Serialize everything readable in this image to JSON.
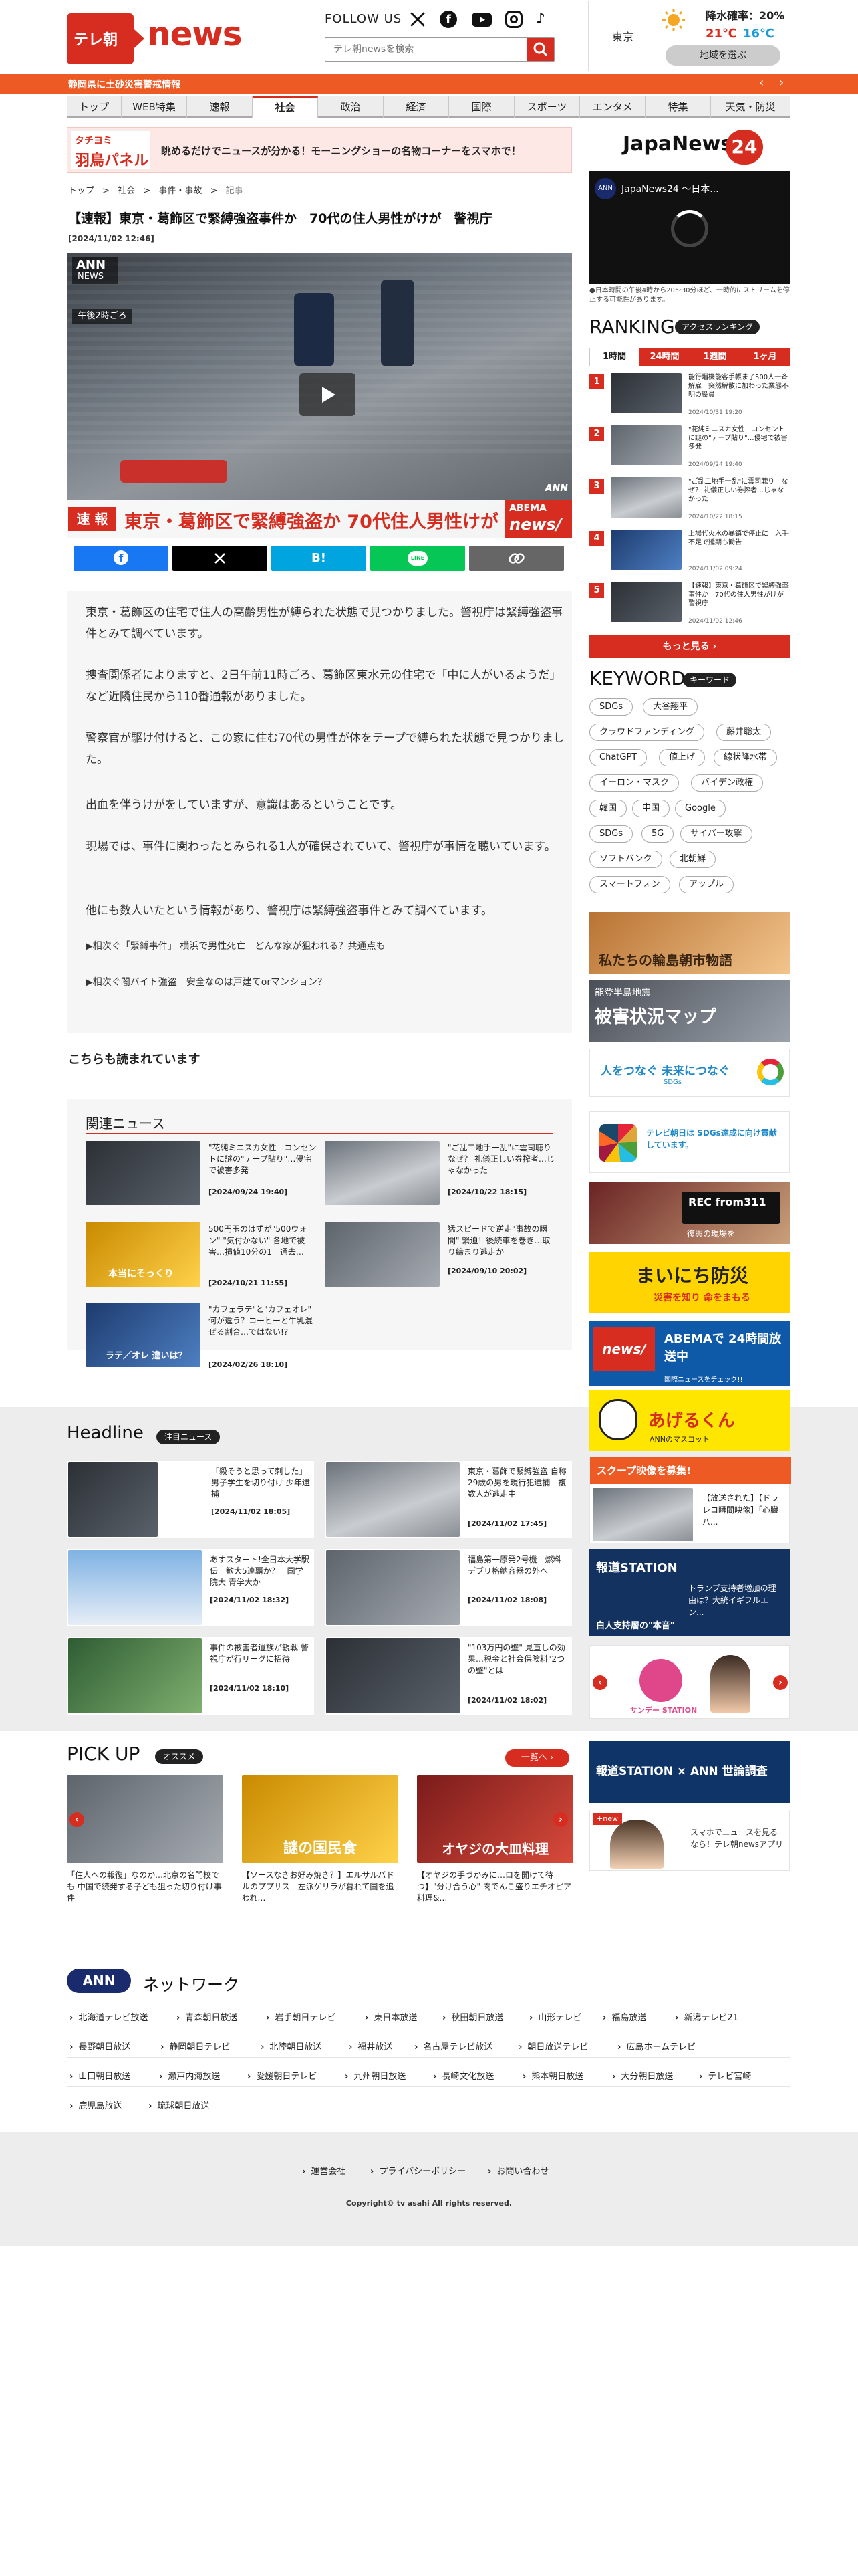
{
  "header": {
    "logo_mark": "テレ朝",
    "logo_word": "news",
    "follow_label": "FOLLOW US",
    "search_placeholder": "テレ朝newsを検索",
    "weather": {
      "city": "東京",
      "precip_label": "降水確率：20%",
      "temp_high": "21℃",
      "temp_low": "16℃",
      "region_button": "地域を選ぶ"
    }
  },
  "alert_bar": {
    "text": "静岡県に土砂災害警戒情報"
  },
  "nav": {
    "items": [
      "トップ",
      "WEB特集",
      "速報",
      "社会",
      "政治",
      "経済",
      "国際",
      "スポーツ",
      "エンタメ",
      "特集",
      "天気・防災"
    ],
    "active": "社会"
  },
  "promo_banner": {
    "badge_top": "タチヨミ",
    "badge_bottom": "羽鳥パネル",
    "text": "眺めるだけでニュースが分かる！モーニングショーの名物コーナーをスマホで！"
  },
  "breadcrumb": [
    "トップ",
    "社会",
    "事件・事故",
    "記事"
  ],
  "article": {
    "title": "【速報】東京・葛飾区で緊縛強盗事件か　70代の住人男性がけが　警視庁",
    "date": "[2024/11/02 12:46]",
    "video": {
      "ann_logo": "ANN",
      "news_logo": "NEWS",
      "time_label": "午後2時ごろ",
      "breaking_badge": "速 報",
      "caption": "東京・葛飾区で緊縛強盗か 70代住人男性けが",
      "abema_top": "ABEMA",
      "abema_bottom": "news/",
      "ann_corner": "ANN"
    },
    "share": [
      "Facebook",
      "X",
      "B!",
      "LINE",
      "リンク"
    ],
    "paragraphs": [
      "東京・葛飾区の住宅で住人の高齢男性が縛られた状態で見つかりました。警視庁は緊縛強盗事件とみて調べています。",
      "捜査関係者によりますと、2日午前11時ごろ、葛飾区東水元の住宅で「中に人がいるようだ」など近隣住民から110番通報がありました。",
      "警察官が駆け付けると、この家に住む70代の男性が体をテープで縛られた状態で見つかりました。",
      "出血を伴うけがをしていますが、意識はあるということです。",
      "現場では、事件に関わったとみられる1人が確保されていて、警視庁が事情を聴いています。",
      "他にも数人いたという情報があり、警視庁は緊縛強盗事件とみて調べています。"
    ],
    "related_links": [
      "▶相次ぐ「緊縛事件」 横浜で男性死亡　どんな家が狙われる？共通点も",
      "▶相次ぐ闇バイト強盗　安全なのは戸建てorマンション？"
    ]
  },
  "also_read": {
    "title": "こちらも読まれています"
  },
  "related_news": {
    "title": "関連ニュース",
    "items": [
      {
        "title": "\"花純ミニスカ女性　コンセントに謎の\"テープ貼り\"…侵宅で被害多発",
        "date": "[2024/09/24 19:40]"
      },
      {
        "title": "\"ご乱二地手一乱\"に雲司聴り　なぜ？ 礼儀正しい券搾者…じゃなかった",
        "date": "[2024/10/22 18:15]"
      },
      {
        "title": "500円玉のはずが\"500ウォン\" \"気付かない\" 各地で被害…損値10分の1　通去…",
        "date": "[2024/10/21 11:55]",
        "thumb_text": "本当にそっくり"
      },
      {
        "title": "猛スピードで逆走\"事故の瞬間\" 緊迫！後続車を巻き…取り締まり逃走か",
        "date": "[2024/09/10 20:02]"
      },
      {
        "title": "\"カフェラテ\"と\"カフェオレ\" 何が違う？コーヒーと牛乳混ぜる割合…ではない!?",
        "date": "[2024/02/26 18:10]",
        "thumb_text": "ラテ／オレ 違いは？"
      }
    ]
  },
  "headline": {
    "title": "Headline",
    "badge": "注目ニュース",
    "items": [
      {
        "title": "「殺そうと思って刺した」男子学生を切り付け 少年逮捕",
        "date": "[2024/11/02 18:05]"
      },
      {
        "title": "東京・葛飾で緊縛強盗 自称29歳の男を現行犯逮捕　複数人が逃走中",
        "date": "[2024/11/02 17:45]"
      },
      {
        "title": "あすスタート!全日本大学駅伝　歓大5連覇か？　国学院大 青学大か",
        "date": "[2024/11/02 18:32]"
      },
      {
        "title": "福島第一原発2号機　燃料デブリ格納容器の外へ",
        "date": "[2024/11/02 18:08]"
      },
      {
        "title": "事件の被害者遺族が観戦 警視庁が行リーグに招待",
        "date": "[2024/11/02 18:10]"
      },
      {
        "title": "\"103万円の壁\" 見直しの効果…税金と社会保険料\"2つの壁\"とは",
        "date": "[2024/11/02 18:02]"
      }
    ]
  },
  "pickup": {
    "title": "PICK UP",
    "badge": "オススメ",
    "more_label": "一覧へ",
    "items": [
      {
        "title": "「住人への報復」なのか…北京の名門校でも 中国で続発する子ども狙った切り付け事件"
      },
      {
        "title": "【ソースなきお好み焼き？】エルサルバドルのププサス　左派ゲリラが暮れて国を追われ…",
        "thumb_text": "謎の国民食"
      },
      {
        "title": "【オヤジの手づかみに…ロを開けて待つ】\"分け合う心\" 肉でんこ盛りエチオピア料理&…",
        "thumb_text": "オヤジの大皿料理"
      }
    ]
  },
  "sidebar": {
    "japannews": {
      "logo": "JapaNews",
      "logo_num": "24",
      "video_title": "JapaNews24 ～日本...",
      "note": "●日本時間の午後4時から20～30分ほど、一時的にストリームを停止する可能性があります。"
    },
    "ranking": {
      "title": "RANKING",
      "badge": "アクセスランキング",
      "tabs": [
        "1時間",
        "24時間",
        "1週間",
        "1ヶ月"
      ],
      "active_tab": "1時間",
      "items": [
        {
          "rank": "1",
          "title": "能行増機能客手帳ま了500人一斉解雇　突然解散に加わった業態不明の役員",
          "date": "2024/10/31 19:20"
        },
        {
          "rank": "2",
          "title": "\"花純ミニスカ女性　コンセントに謎の\"テープ貼り\"…侵宅で被害多発",
          "date": "2024/09/24 19:40"
        },
        {
          "rank": "3",
          "title": "\"ご乱二地手一乱\"に雲司聴り　なぜ？ 礼儀正しい券搾者…じゃなかった",
          "date": "2024/10/22 18:15"
        },
        {
          "rank": "4",
          "title": "上場代火水の暴鎮で停止に　入手不足で延期も勧告",
          "date": "2024/11/02 09:24"
        },
        {
          "rank": "5",
          "title": "【速報】東京・葛飾区で緊縛強盗事件か　70代の住人男性がけが　警視庁",
          "date": "2024/11/02 12:46"
        }
      ],
      "more_label": "もっと見る"
    },
    "keyword": {
      "title": "KEYWORD",
      "badge": "キーワード",
      "items": [
        "SDGs",
        "大谷翔平",
        "クラウドファンディング",
        "藤井聡太",
        "ChatGPT",
        "値上げ",
        "線状降水帯",
        "イーロン・マスク",
        "バイデン政権",
        "韓国",
        "中国",
        "Google",
        "SDGs",
        "5G",
        "サイバー攻撃",
        "ソフトバンク",
        "北朝鮮",
        "スマートフォン",
        "アップル"
      ]
    },
    "banners": [
      {
        "name": "wajima",
        "text": "私たちの輪島朝市物語"
      },
      {
        "name": "noto-map",
        "top": "能登半島地震",
        "text": "被害状況マップ"
      },
      {
        "name": "sdgs-link",
        "text": "人をつなぐ 未来につなぐ",
        "sub": "SDGs"
      },
      {
        "name": "sdgs-goal",
        "text": "テレビ朝日は SDGs達成に向け貢献しています。"
      },
      {
        "name": "rec311",
        "text": "REC from311",
        "sub": "復興の現場を"
      },
      {
        "name": "bousai",
        "text": "まいにち防災",
        "sub": "災害を知り 命をまもる"
      },
      {
        "name": "abema",
        "text": "ABEMAで 24時間放送中",
        "sub": "国際ニュースをチェック!!"
      },
      {
        "name": "ageru",
        "text": "あげるくん",
        "sub": "ANNのマスコット"
      },
      {
        "name": "scoop",
        "text": "スクープ映像を募集!",
        "item": "【放送された】【ドラレコ瞬間映像】「心臓八..."
      },
      {
        "name": "houdou",
        "text": "報道STATION",
        "item": "トランプ支持者増加の理由は？大統イギフルエン...",
        "sub": "白人支持層の\"本音\""
      },
      {
        "name": "sunday",
        "text": "サンデー STATION"
      },
      {
        "name": "poll",
        "text": "報道STATION × ANN 世論調査"
      },
      {
        "name": "app",
        "badge": "+new",
        "text": "スマホでニュースを見るなら！テレ朝newsアプリ"
      }
    ]
  },
  "network": {
    "ann": "ANN",
    "title": "ネットワーク",
    "stations": [
      "北海道テレビ放送",
      "青森朝日放送",
      "岩手朝日テレビ",
      "東日本放送",
      "秋田朝日放送",
      "山形テレビ",
      "福島放送",
      "新潟テレビ21",
      "長野朝日放送",
      "静岡朝日テレビ",
      "北陸朝日放送",
      "福井放送",
      "名古屋テレビ放送",
      "朝日放送テレビ",
      "広島ホームテレビ",
      "山口朝日放送",
      "瀬戸内海放送",
      "愛媛朝日テレビ",
      "九州朝日放送",
      "長崎文化放送",
      "熊本朝日放送",
      "大分朝日放送",
      "テレビ宮崎",
      "鹿児島放送",
      "琉球朝日放送"
    ]
  },
  "footer": {
    "links": [
      "運営会社",
      "プライバシーポリシー",
      "お問い合わせ"
    ],
    "copyright": "Copyright© tv asahi All rights reserved."
  },
  "colors": {
    "brand_red": "#d62d20",
    "brand_orange": "#ee5a24",
    "ann_navy": "#1a2b6d",
    "nav_bg": "#ededed"
  }
}
